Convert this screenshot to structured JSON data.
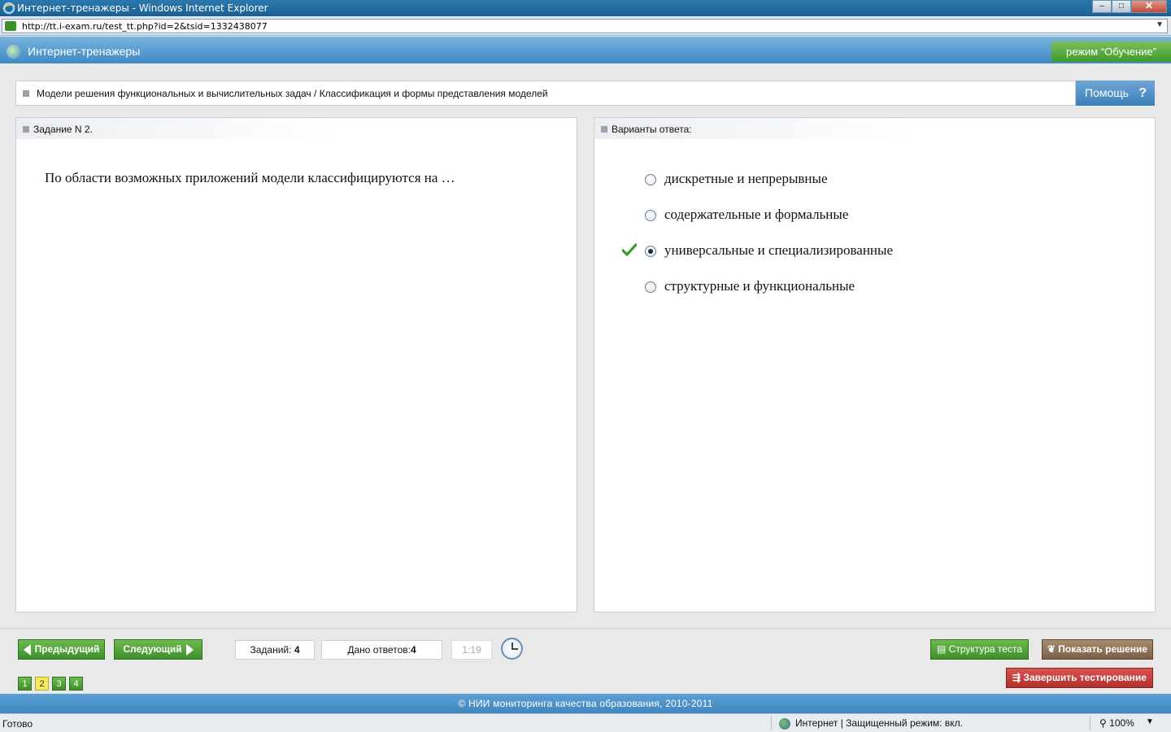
{
  "window": {
    "title": "Интернет-тренажеры - Windows Internet Explorer",
    "controls": {
      "minimize": "–",
      "maximize": "□",
      "close": "✕"
    }
  },
  "address_bar": {
    "url": "http://tt.i-exam.ru/test_tt.php?id=2&tsid=1332438077"
  },
  "header": {
    "app_name": "Интернет-тренажеры",
    "mode_label": "режим “Обучение”"
  },
  "breadcrumb": {
    "text": "Модели решения функциональных и вычислительных задач / Классификация и формы представления моделей"
  },
  "help": {
    "label": "Помощь",
    "icon": "?"
  },
  "task_panel": {
    "title": "Задание N 2.",
    "question": "По области возможных приложений модели классифицируются на …"
  },
  "answers_panel": {
    "title": "Варианты ответа:",
    "options": [
      {
        "label": "дискретные и непрерывные",
        "selected": false,
        "correct_mark": false
      },
      {
        "label": "содержательные и формальные",
        "selected": false,
        "correct_mark": false
      },
      {
        "label": "универсальные и специализированные",
        "selected": true,
        "correct_mark": true
      },
      {
        "label": "структурные и функциональные",
        "selected": false,
        "correct_mark": false
      }
    ]
  },
  "navigation": {
    "prev_label": "Предыдущий",
    "next_label": "Следующий",
    "tasks_label": "Заданий:",
    "tasks_count": "4",
    "answers_label": "Дано ответов:",
    "answers_count": "4",
    "timer": "1:19",
    "structure_label": "Структура теста",
    "solution_label": "Показать решение",
    "finish_label": "Завершить тестирование",
    "pages": [
      {
        "num": "1",
        "current": false
      },
      {
        "num": "2",
        "current": true
      },
      {
        "num": "3",
        "current": false
      },
      {
        "num": "4",
        "current": false
      }
    ]
  },
  "footer": {
    "copyright": "© НИИ мониторинга качества образования, 2010-2011"
  },
  "status_bar": {
    "status": "Готово",
    "zone": "Интернет | Защищенный режим: вкл.",
    "zoom": "100%"
  },
  "colors": {
    "header_blue": "#3f8ac4",
    "button_green": "#3e8f2b",
    "button_brown": "#7a6046",
    "button_red": "#b3302c",
    "current_page": "#f4ea5a",
    "check_green": "#3a9a2a"
  },
  "icons": {
    "browser": "ie-icon",
    "app": "globe-logo-icon",
    "help": "question-icon",
    "correct": "checkmark-icon",
    "timer": "clock-icon",
    "structure": "list-icon",
    "solution": "book-icon",
    "finish": "runner-icon",
    "zone": "globe-icon",
    "zoom": "magnifier-icon"
  }
}
